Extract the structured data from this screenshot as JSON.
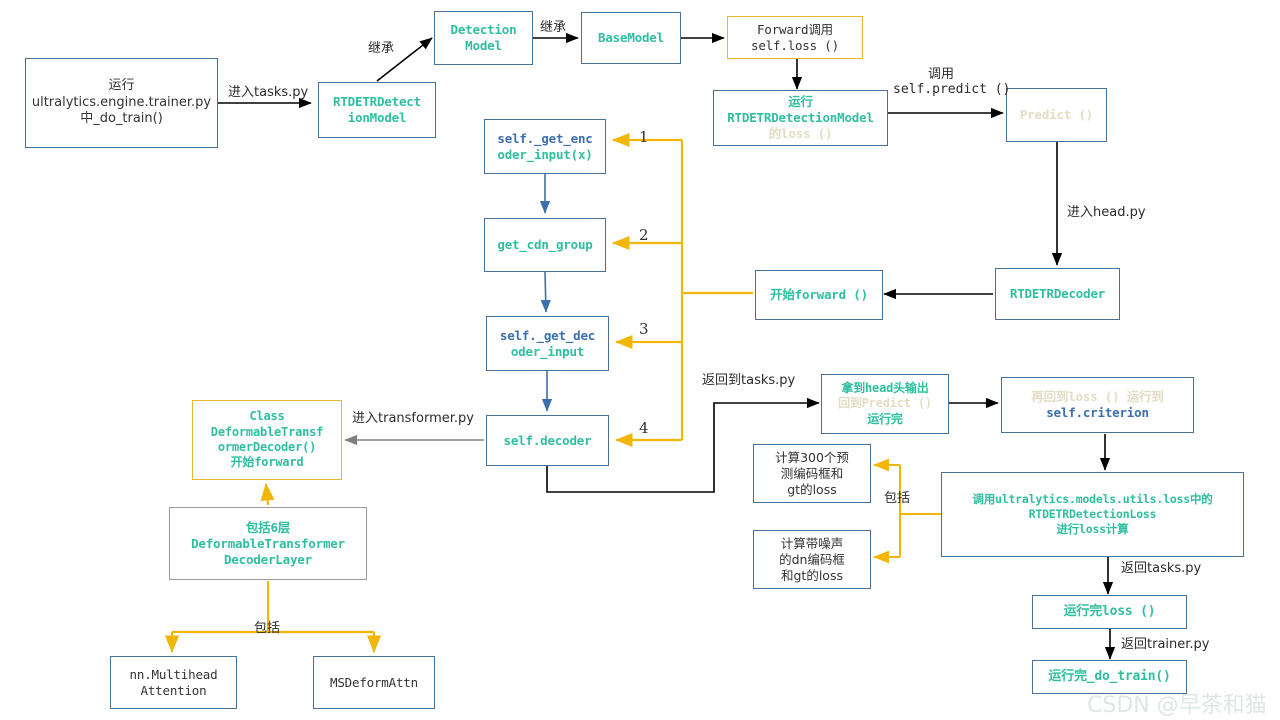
{
  "diagram": {
    "title": "RT-DETR ultralytics training call flow",
    "colors": {
      "teal": "#2fbfa0",
      "blue": "#3d6fae",
      "pale": "#e2ddc5",
      "border_blue": "#4a7296",
      "border_yellow": "#e8b92a",
      "border_gray": "#9a9a9a",
      "arrow_black": "#000000",
      "arrow_yellow": "#f2b705",
      "arrow_blue": "#3d6fae",
      "arrow_gray": "#808080"
    },
    "nodes": [
      {
        "id": "trainer",
        "lines": [
          {
            "text": "运行",
            "style": "sans-dark"
          },
          {
            "text": "ultralytics.engine.trainer.py",
            "style": "sans-dark"
          },
          {
            "text": "中_do_train()",
            "style": "sans-dark"
          }
        ]
      },
      {
        "id": "rtdetr_model",
        "lines": [
          {
            "text": "RTDETRDetect",
            "style": "mono-teal"
          },
          {
            "text": "ionModel",
            "style": "mono-teal"
          }
        ]
      },
      {
        "id": "detection_model",
        "lines": [
          {
            "text": "Detection",
            "style": "mono-teal"
          },
          {
            "text": "Model",
            "style": "mono-teal"
          }
        ]
      },
      {
        "id": "base_model",
        "lines": [
          {
            "text": "BaseModel",
            "style": "mono-teal"
          }
        ]
      },
      {
        "id": "forward_call",
        "lines": [
          {
            "text": "Forward调用",
            "style": "mono-dark"
          },
          {
            "text": "self.loss ()",
            "style": "mono-dark"
          }
        ]
      },
      {
        "id": "run_loss",
        "lines": [
          {
            "text": "运行",
            "style": "mono-teal"
          },
          {
            "text": "RTDETRDetectionModel",
            "style": "mono-teal"
          },
          {
            "text": "的loss ()",
            "style": "mono-teal-pale"
          }
        ]
      },
      {
        "id": "predict",
        "lines": [
          {
            "text": "Predict ()",
            "style": "mono-pale"
          }
        ]
      },
      {
        "id": "rtdetr_decoder",
        "lines": [
          {
            "text": "RTDETRDecoder",
            "style": "mono-teal"
          }
        ]
      },
      {
        "id": "begin_forward",
        "lines": [
          {
            "text": "开始forward ()",
            "style": "mono-teal"
          }
        ]
      },
      {
        "id": "get_encoder",
        "lines": [
          {
            "text": "self._get_enc",
            "style": "mono-blue"
          },
          {
            "text": "oder_input(x)",
            "style": "mono-teal"
          }
        ]
      },
      {
        "id": "get_cdn_group",
        "lines": [
          {
            "text": "get_cdn_group",
            "style": "mono-teal"
          }
        ]
      },
      {
        "id": "get_decoder",
        "lines": [
          {
            "text": "self._get_dec",
            "style": "mono-blue"
          },
          {
            "text": "oder_input",
            "style": "mono-teal"
          }
        ]
      },
      {
        "id": "self_decoder",
        "lines": [
          {
            "text": "self.decoder",
            "style": "mono-teal"
          }
        ]
      },
      {
        "id": "class_deform",
        "lines": [
          {
            "text": "Class",
            "style": "mono-teal"
          },
          {
            "text": "DeformableTransf",
            "style": "mono-teal"
          },
          {
            "text": "ormerDecoder()",
            "style": "mono-teal"
          },
          {
            "text": "开始forward",
            "style": "mono-teal"
          }
        ]
      },
      {
        "id": "six_layers",
        "lines": [
          {
            "text": "包括6层",
            "style": "mono-teal"
          },
          {
            "text": "DeformableTransformer",
            "style": "mono-teal"
          },
          {
            "text": "DecoderLayer",
            "style": "mono-teal"
          }
        ]
      },
      {
        "id": "multihead",
        "lines": [
          {
            "text": "nn.Multihead",
            "style": "mono-dark"
          },
          {
            "text": "Attention",
            "style": "mono-dark"
          }
        ]
      },
      {
        "id": "msdeform",
        "lines": [
          {
            "text": "MSDeformAttn",
            "style": "mono-dark"
          }
        ]
      },
      {
        "id": "head_out",
        "lines": [
          {
            "text": "拿到head头输出",
            "style": "mono-teal"
          },
          {
            "text": "回到Predict ()",
            "style": "mono-teal-pale"
          },
          {
            "text": "运行完",
            "style": "mono-teal"
          }
        ]
      },
      {
        "id": "back_to_loss",
        "lines": [
          {
            "text": "再回到loss () 运行到",
            "style": "mono-teal-pale"
          },
          {
            "text": "self.criterion",
            "style": "mono-blue"
          }
        ]
      },
      {
        "id": "loss300",
        "lines": [
          {
            "text": "计算300个预",
            "style": "sans-dark"
          },
          {
            "text": "测编码框和",
            "style": "sans-dark"
          },
          {
            "text": "gt的loss",
            "style": "sans-dark"
          }
        ]
      },
      {
        "id": "lossdn",
        "lines": [
          {
            "text": "计算带噪声",
            "style": "sans-dark"
          },
          {
            "text": "的dn编码框",
            "style": "sans-dark"
          },
          {
            "text": "和gt的loss",
            "style": "sans-dark"
          }
        ]
      },
      {
        "id": "call_rtdetrloss",
        "lines": [
          {
            "text": "调用ultralytics.models.utils.loss中的",
            "style": "mono-teal"
          },
          {
            "text": "RTDETRDetectionLoss",
            "style": "mono-teal"
          },
          {
            "text": "进行loss计算",
            "style": "mono-teal"
          }
        ]
      },
      {
        "id": "loss_done",
        "lines": [
          {
            "text": "运行完loss ()",
            "style": "mono-teal-pale"
          }
        ]
      },
      {
        "id": "train_done",
        "lines": [
          {
            "text": "运行完_do_train()",
            "style": "mono-teal-dark"
          }
        ]
      }
    ],
    "edge_labels": {
      "enter_tasks": "进入tasks.py",
      "inherit_1": "继承",
      "inherit_2": "继承",
      "call_predict_l1": "调用",
      "call_predict_l2": "self.predict ()",
      "enter_head": "进入head.py",
      "enter_transformer": "进入transformer.py",
      "return_to_tasks": "返回到tasks.py",
      "includes_mid": "包括",
      "includes_bottom": "包括",
      "return_tasks": "返回tasks.py",
      "return_trainer": "返回trainer.py"
    },
    "step_numbers": [
      "1",
      "2",
      "3",
      "4"
    ],
    "watermark": "CSDN @早茶和猫"
  }
}
